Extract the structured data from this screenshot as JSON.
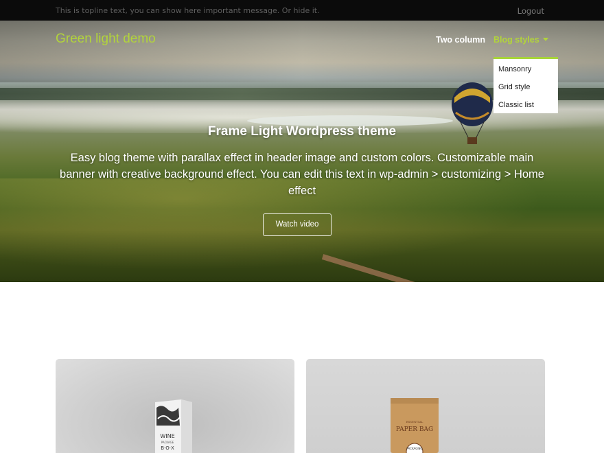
{
  "topline": {
    "message": "This is topline text, you can show here important message. Or hide it.",
    "logout": "Logout"
  },
  "header": {
    "brand": "Green light demo",
    "nav": {
      "two_column": "Two column",
      "blog_styles": "Blog styles"
    },
    "dropdown": [
      "Mansonry",
      "Grid style",
      "Classic list"
    ]
  },
  "hero": {
    "title": "Frame Light Wordpress theme",
    "text": "Easy blog theme with parallax effect in header image and custom colors. Customizable main banner with creative background effect. You can edit this text in wp-admin > customizing > Home effect",
    "button": "Watch video"
  },
  "cards": [
    {
      "image": "wine-package-box",
      "label": [
        "WINE",
        "PACKAGE",
        "B·O·X"
      ]
    },
    {
      "image": "paper-bag",
      "label": [
        "ESSENTIAL",
        "PAPER BAG",
        "PACKAGING"
      ]
    }
  ],
  "colors": {
    "accent": "#b2d43b",
    "topline_bg": "#0b0b0b",
    "dropdown_border": "#a8d43a"
  }
}
